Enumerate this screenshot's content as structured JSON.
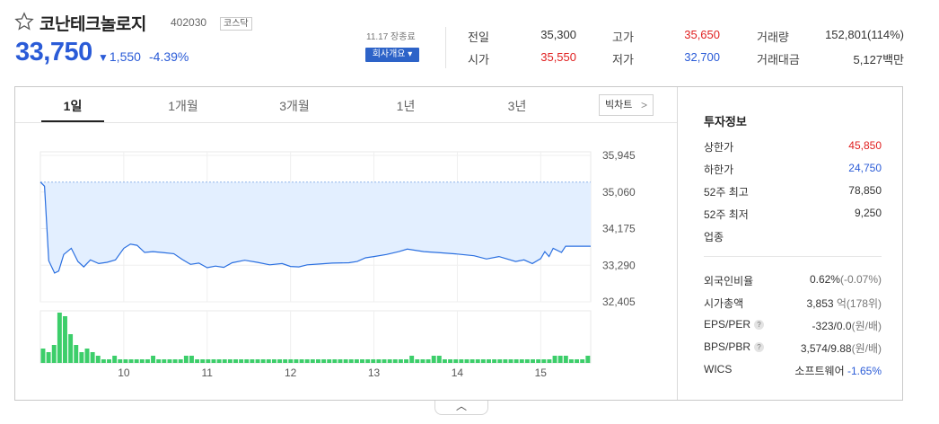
{
  "stock": {
    "name": "코난테크놀로지",
    "code": "402030",
    "market": "코스닥",
    "price": "33,750",
    "change_arrow": "▼",
    "change": "1,550",
    "change_rate": "-4.39%"
  },
  "session": {
    "status": "11.17 장종료",
    "company_button": "회사개요 ▾"
  },
  "stats": {
    "prev_label": "전일",
    "prev": "35,300",
    "high_label": "고가",
    "high": "35,650",
    "volume_label": "거래량",
    "volume": "152,801(114%)",
    "open_label": "시가",
    "open": "35,550",
    "low_label": "저가",
    "low": "32,700",
    "value_label": "거래대금",
    "value": "5,127백만"
  },
  "tabs": [
    "1일",
    "1개월",
    "3개월",
    "1년",
    "3년"
  ],
  "active_tab": "1일",
  "bigchart_label": "빅차트",
  "chart_data": {
    "type": "line",
    "y_ticks": [
      "35,945",
      "35,060",
      "34,175",
      "33,290",
      "32,405"
    ],
    "y_tick_values": [
      35945,
      35060,
      34175,
      33290,
      32405
    ],
    "ylim": [
      32405,
      35945
    ],
    "prev_close": 35300,
    "x_ticks": [
      "10",
      "11",
      "12",
      "13",
      "14",
      "15"
    ],
    "x_tick_hours": [
      10,
      11,
      12,
      13,
      14,
      15
    ],
    "xlim": [
      9,
      15.6
    ],
    "series": [
      {
        "values": [
          [
            9.0,
            35300
          ],
          [
            9.05,
            35200
          ],
          [
            9.1,
            33400
          ],
          [
            9.17,
            33100
          ],
          [
            9.22,
            33150
          ],
          [
            9.28,
            33550
          ],
          [
            9.37,
            33700
          ],
          [
            9.45,
            33380
          ],
          [
            9.52,
            33250
          ],
          [
            9.6,
            33420
          ],
          [
            9.7,
            33330
          ],
          [
            9.8,
            33360
          ],
          [
            9.9,
            33420
          ],
          [
            10.0,
            33700
          ],
          [
            10.08,
            33800
          ],
          [
            10.16,
            33770
          ],
          [
            10.25,
            33600
          ],
          [
            10.35,
            33620
          ],
          [
            10.45,
            33600
          ],
          [
            10.6,
            33570
          ],
          [
            10.7,
            33430
          ],
          [
            10.8,
            33310
          ],
          [
            10.9,
            33340
          ],
          [
            11.0,
            33230
          ],
          [
            11.1,
            33270
          ],
          [
            11.2,
            33240
          ],
          [
            11.3,
            33350
          ],
          [
            11.45,
            33410
          ],
          [
            11.6,
            33360
          ],
          [
            11.75,
            33300
          ],
          [
            11.9,
            33330
          ],
          [
            12.0,
            33260
          ],
          [
            12.1,
            33250
          ],
          [
            12.2,
            33300
          ],
          [
            12.35,
            33320
          ],
          [
            12.5,
            33340
          ],
          [
            12.7,
            33350
          ],
          [
            12.8,
            33380
          ],
          [
            12.9,
            33470
          ],
          [
            13.0,
            33500
          ],
          [
            13.15,
            33550
          ],
          [
            13.3,
            33620
          ],
          [
            13.4,
            33680
          ],
          [
            13.6,
            33620
          ],
          [
            13.8,
            33590
          ],
          [
            14.0,
            33560
          ],
          [
            14.2,
            33520
          ],
          [
            14.35,
            33440
          ],
          [
            14.5,
            33500
          ],
          [
            14.7,
            33380
          ],
          [
            14.8,
            33420
          ],
          [
            14.9,
            33330
          ],
          [
            15.0,
            33450
          ],
          [
            15.05,
            33620
          ],
          [
            15.1,
            33500
          ],
          [
            15.15,
            33700
          ],
          [
            15.25,
            33600
          ],
          [
            15.3,
            33750
          ],
          [
            15.6,
            33750
          ]
        ]
      }
    ],
    "volume": [
      4,
      3,
      5,
      14,
      13,
      8,
      5,
      3,
      4,
      3,
      2,
      1,
      1,
      2,
      1,
      1,
      1,
      1,
      1,
      1,
      2,
      1,
      1,
      1,
      1,
      1,
      2,
      2,
      1,
      1,
      1,
      1,
      1,
      1,
      1,
      1,
      1,
      1,
      1,
      1,
      1,
      1,
      1,
      1,
      1,
      1,
      1,
      1,
      1,
      1,
      1,
      1,
      1,
      1,
      1,
      1,
      1,
      1,
      1,
      1,
      1,
      1,
      1,
      1,
      1,
      1,
      1,
      2,
      1,
      1,
      1,
      2,
      2,
      1,
      1,
      1,
      1,
      1,
      1,
      1,
      1,
      1,
      1,
      1,
      1,
      1,
      1,
      1,
      1,
      1,
      1,
      1,
      1,
      2,
      2,
      2,
      1,
      1,
      1,
      2
    ]
  },
  "invest": {
    "title": "투자정보",
    "upper_label": "상한가",
    "upper": "45,850",
    "lower_label": "하한가",
    "lower": "24,750",
    "high52_label": "52주 최고",
    "high52": "78,850",
    "low52_label": "52주 최저",
    "low52": "9,250",
    "sector_label": "업종",
    "foreign_label": "외국인비율",
    "foreign": "0.62%",
    "foreign_change": "(-0.07%)",
    "cap_label": "시가총액",
    "cap": "3,853",
    "cap_unit": "억(178위)",
    "eps_label": "EPS/PER",
    "eps": "-323/0.0",
    "eps_unit": "(원/배)",
    "bps_label": "BPS/PBR",
    "bps": "3,574/9.88",
    "bps_unit": "(원/배)",
    "wics_label": "WICS",
    "wics": "소프트웨어",
    "wics_change": "-1.65%",
    "help_glyph": "?"
  },
  "colors": {
    "up": "#e02020",
    "down": "#2a5bd7",
    "line": "#2a6fe0",
    "fill": "#e3efff",
    "volume": "#3cce6a"
  }
}
